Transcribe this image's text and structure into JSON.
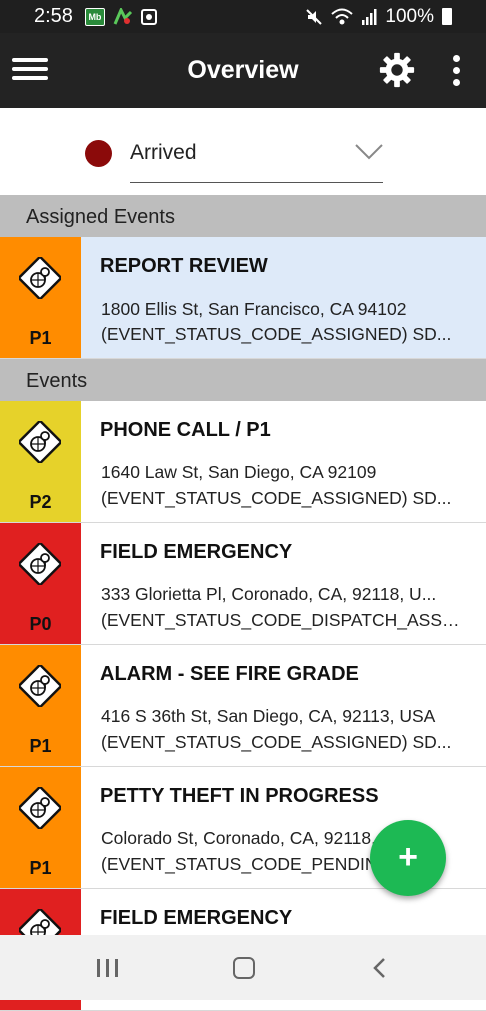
{
  "status_bar": {
    "time": "2:58",
    "battery": "100%",
    "notif_icons": [
      "Mb",
      "map-icon",
      "photo-icon"
    ]
  },
  "app_bar": {
    "title": "Overview"
  },
  "unit_status": {
    "value": "Arrived",
    "color": "#8b0a0a"
  },
  "sections": {
    "assigned": "Assigned Events",
    "events": "Events"
  },
  "assigned_events": [
    {
      "title": "REPORT REVIEW",
      "address": "1800 Ellis St, San Francisco, CA 94102",
      "status": "(EVENT_STATUS_CODE_ASSIGNED)  SD...",
      "priority": "P1",
      "color": "#ff8c00"
    }
  ],
  "events": [
    {
      "title": "PHONE CALL  / P1",
      "address": "1640 Law St, San Diego, CA 92109",
      "status": "(EVENT_STATUS_CODE_ASSIGNED)  SD...",
      "priority": "P2",
      "color": "#e6d22a"
    },
    {
      "title": "FIELD EMERGENCY",
      "address": "333 Glorietta Pl, Coronado, CA, 92118, U...",
      "status": "(EVENT_STATUS_CODE_DISPATCH_ASSI...",
      "priority": "P0",
      "color": "#e02020"
    },
    {
      "title": "ALARM - SEE FIRE GRADE",
      "address": "416 S 36th St, San Diego, CA, 92113, USA",
      "status": "(EVENT_STATUS_CODE_ASSIGNED)  SD...",
      "priority": "P1",
      "color": "#ff8c00"
    },
    {
      "title": "PETTY THEFT IN PROGRESS",
      "address": "Colorado St, Coronado, CA, 92118, USA",
      "status": "(EVENT_STATUS_CODE_PENDING)  SD...",
      "priority": "P1",
      "color": "#ff8c00"
    },
    {
      "title": "FIELD EMERGENCY",
      "address": "",
      "status": "",
      "priority": "",
      "color": "#e02020"
    }
  ],
  "fab": {
    "label": "+"
  },
  "colors": {
    "appbar": "#232323",
    "section": "#bdbdbd",
    "selected": "#deeaf9",
    "fab": "#1db954"
  }
}
